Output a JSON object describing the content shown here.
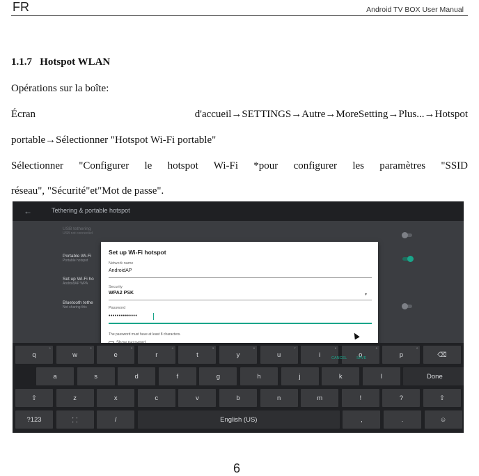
{
  "header": {
    "left": "FR",
    "right": "Android TV BOX User Manual"
  },
  "section": {
    "number": "1.1.7",
    "title": "Hotspot WLAN"
  },
  "paragraphs": {
    "p1": "Opérations sur la boîte:",
    "p2a_left": "Écran",
    "p2a_right": "d'accueil→SETTINGS→Autre→MoreSetting→Plus...→Hotspot",
    "p2b": "portable→Sélectionner \"Hotspot Wi-Fi portable\"",
    "p3a": "Sélectionner \"Configurer le hotspot Wi-Fi *pour configurer les paramètres \"SSID",
    "p3b": "réseau\", \"Sécurité\"et\"Mot de passe\"."
  },
  "screenshot": {
    "topbar": {
      "back": "←",
      "title": "Tethering & portable hotspot"
    },
    "settings_rows": [
      {
        "title": "USB tethering",
        "subtitle": "USB not connected"
      },
      {
        "title": "Portable Wi-Fi",
        "subtitle": "Portable hotspot"
      },
      {
        "title": "Set up Wi-Fi ho",
        "subtitle": "AndroidAP WPA"
      },
      {
        "title": "Bluetooth tethe",
        "subtitle": "Not sharing this"
      }
    ],
    "dialog": {
      "title": "Set up Wi-Fi hotspot",
      "network_label": "Network name",
      "network_value": "AndroidAP",
      "security_label": "Security",
      "security_value": "WPA2 PSK",
      "password_label": "Password",
      "password_value": "••••••••••••••",
      "hint": "The password must have at least 8 characters.",
      "show_password": "Show password",
      "cancel": "CANCEL",
      "save": "SAVE"
    },
    "keyboard": {
      "row1": [
        {
          "k": "q",
          "n": "1"
        },
        {
          "k": "w",
          "n": "2"
        },
        {
          "k": "e",
          "n": "3"
        },
        {
          "k": "r",
          "n": "4"
        },
        {
          "k": "t",
          "n": "5"
        },
        {
          "k": "y",
          "n": "6"
        },
        {
          "k": "u",
          "n": "7"
        },
        {
          "k": "i",
          "n": "8"
        },
        {
          "k": "o",
          "n": "9"
        },
        {
          "k": "p",
          "n": "0"
        },
        {
          "k": "⌫",
          "n": ""
        }
      ],
      "row2": [
        "a",
        "s",
        "d",
        "f",
        "g",
        "h",
        "j",
        "k",
        "l",
        "Done"
      ],
      "row3": [
        "⇧",
        "z",
        "x",
        "c",
        "v",
        "b",
        "n",
        "m",
        "!",
        "?",
        "⇧"
      ],
      "row4": [
        "?123",
        "⸬",
        "/",
        "English (US)",
        ",",
        ".",
        "☺"
      ]
    }
  },
  "page_number": "6"
}
